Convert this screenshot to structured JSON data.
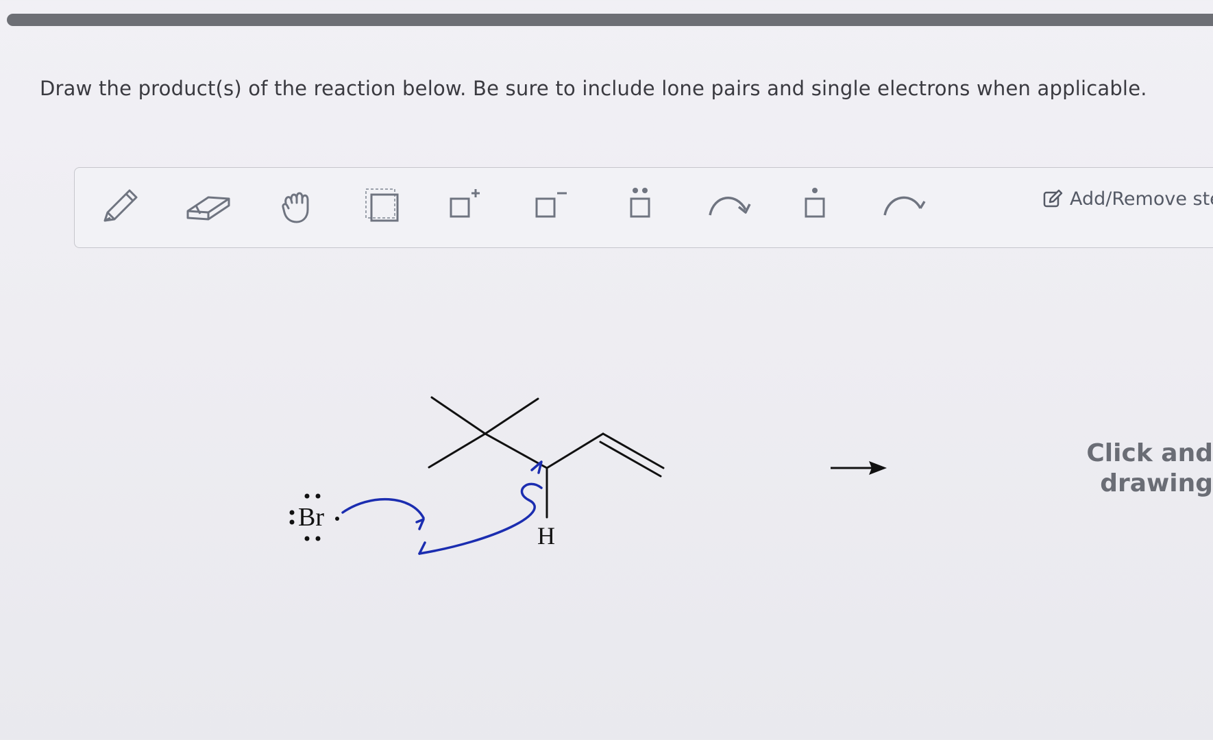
{
  "instruction": "Draw the product(s) of the reaction below. Be sure to include lone pairs and single electrons when applicable.",
  "toolbar": {
    "tools": [
      {
        "name": "pencil-tool",
        "icon": "pencil-icon"
      },
      {
        "name": "eraser-tool",
        "icon": "eraser-icon"
      },
      {
        "name": "hand-tool",
        "icon": "hand-icon"
      },
      {
        "name": "select-box-tool",
        "icon": "dashed-box-icon"
      },
      {
        "name": "positive-charge-tool",
        "icon": "box-plus-icon"
      },
      {
        "name": "negative-charge-tool",
        "icon": "box-minus-icon"
      },
      {
        "name": "lone-pair-tool",
        "icon": "box-lone-pair-icon"
      },
      {
        "name": "electron-pair-arrow-tool",
        "icon": "curved-arrow-icon"
      },
      {
        "name": "single-electron-tool",
        "icon": "box-radical-icon"
      },
      {
        "name": "single-electron-arrow-tool",
        "icon": "fishhook-arrow-icon"
      }
    ],
    "add_remove_label": "Add/Remove ste"
  },
  "molecule": {
    "nucleophile_label": "Br",
    "hydrogen_label": "H"
  },
  "hint": {
    "line1": "Click and",
    "line2": "drawing"
  },
  "colors": {
    "arrow_blue": "#1b2db0",
    "bond": "#111111",
    "toolbar_icon": "#6f7480"
  }
}
